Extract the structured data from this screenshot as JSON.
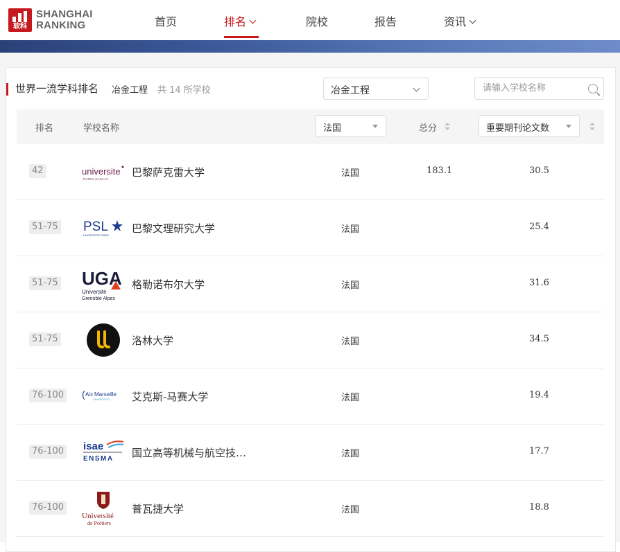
{
  "brand": {
    "logo_cn": "软科",
    "line1": "SHANGHAI",
    "line2": "RANKING"
  },
  "nav": [
    {
      "label": "首页",
      "dropdown": false,
      "active": false
    },
    {
      "label": "排名",
      "dropdown": true,
      "active": true
    },
    {
      "label": "院校",
      "dropdown": false,
      "active": false
    },
    {
      "label": "报告",
      "dropdown": false,
      "active": false
    },
    {
      "label": "资讯",
      "dropdown": true,
      "active": false
    }
  ],
  "colors": {
    "accent": "#c5191f",
    "banner_start": "#2a4178",
    "banner_end": "#6d8cc8"
  },
  "panel": {
    "title": "世界一流学科排名",
    "subject": "冶金工程",
    "count_text": "共 14 所学校",
    "subject_select": "冶金工程",
    "search_placeholder": "请输入学校名称"
  },
  "table": {
    "headers": {
      "rank": "排名",
      "name": "学校名称",
      "country_filter": "法国",
      "total": "总分",
      "indicator": "重要期刊论文数"
    },
    "rows": [
      {
        "rank": "42",
        "name": "巴黎萨克雷大学",
        "country": "法国",
        "score": "183.1",
        "papers": "30.5",
        "logo_text": [
          "universite",
          "PARIS-SACLAY"
        ],
        "logo_icon": "paris-saclay-logo"
      },
      {
        "rank": "51-75",
        "name": "巴黎文理研究大学",
        "country": "法国",
        "score": "",
        "papers": "25.4",
        "logo_text": [
          "PSL",
          "UNIVERSITÉ PARIS"
        ],
        "logo_icon": "psl-logo"
      },
      {
        "rank": "51-75",
        "name": "格勒诺布尔大学",
        "country": "法国",
        "score": "",
        "papers": "31.6",
        "logo_text": [
          "UGA",
          "Université",
          "Grenoble Alpes"
        ],
        "logo_icon": "uga-logo"
      },
      {
        "rank": "51-75",
        "name": "洛林大学",
        "country": "法国",
        "score": "",
        "papers": "34.5",
        "logo_text": [
          "LL"
        ],
        "logo_icon": "lorraine-logo"
      },
      {
        "rank": "76-100",
        "name": "艾克斯-马赛大学",
        "country": "法国",
        "score": "",
        "papers": "19.4",
        "logo_text": [
          "Aix",
          "Marseille",
          "UNIVERSITE"
        ],
        "logo_icon": "aix-marseille-logo"
      },
      {
        "rank": "76-100",
        "name": "国立高等机械与航空技…",
        "country": "法国",
        "score": "",
        "papers": "17.7",
        "logo_text": [
          "isae",
          "ENSMA"
        ],
        "logo_icon": "isae-ensma-logo"
      },
      {
        "rank": "76-100",
        "name": "普瓦捷大学",
        "country": "法国",
        "score": "",
        "papers": "18.8",
        "logo_text": [
          "Université",
          "de Poitiers"
        ],
        "logo_icon": "poitiers-logo"
      }
    ]
  }
}
